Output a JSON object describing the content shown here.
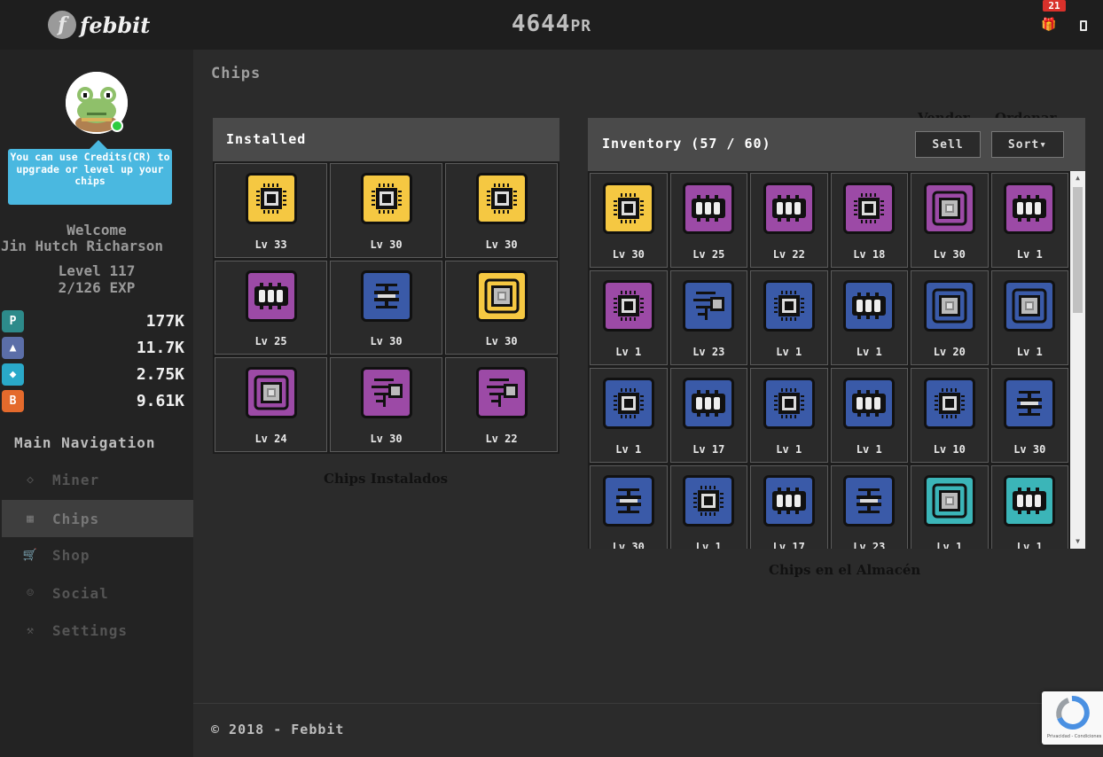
{
  "topbar": {
    "brand": "febbit",
    "pr_value": "4644",
    "pr_unit": "PR",
    "notifications": "21",
    "gift_icon": "gift-icon",
    "mobile_icon": "mobile-icon"
  },
  "sidebar": {
    "tip": "You can use Credits(CR) to upgrade or level up your chips",
    "welcome": "Welcome",
    "username": "Jin Hutch Richarson",
    "level": "Level 117",
    "exp": "2/126 EXP",
    "currencies": [
      {
        "icon": "coin-p-icon",
        "value": "177K",
        "color": "#2d8a8a"
      },
      {
        "icon": "mountain-icon",
        "value": "11.7K",
        "color": "#5b6ea8"
      },
      {
        "icon": "crystal-icon",
        "value": "2.75K",
        "color": "#2aa9c9"
      },
      {
        "icon": "bitcoin-icon",
        "value": "9.61K",
        "color": "#e46a2c"
      }
    ],
    "nav_heading": "Main Navigation",
    "nav": [
      {
        "label": "Miner",
        "icon": "diamond-icon"
      },
      {
        "label": "Chips",
        "icon": "grid-icon"
      },
      {
        "label": "Shop",
        "icon": "cart-icon"
      },
      {
        "label": "Social",
        "icon": "users-icon"
      },
      {
        "label": "Settings",
        "icon": "wrench-icon"
      }
    ]
  },
  "main": {
    "title": "Chips",
    "installed": {
      "title": "Installed",
      "caption": "Chips Instalados",
      "chips": [
        {
          "level": "Lv 33",
          "color": "yellow",
          "type": "cpu"
        },
        {
          "level": "Lv 30",
          "color": "yellow",
          "type": "cpu"
        },
        {
          "level": "Lv 30",
          "color": "yellow",
          "type": "cpu"
        },
        {
          "level": "Lv 25",
          "color": "purple",
          "type": "ram"
        },
        {
          "level": "Lv 30",
          "color": "blue",
          "type": "fan"
        },
        {
          "level": "Lv 30",
          "color": "yellow",
          "type": "core"
        },
        {
          "level": "Lv 24",
          "color": "purple",
          "type": "core"
        },
        {
          "level": "Lv 30",
          "color": "purple",
          "type": "circuit"
        },
        {
          "level": "Lv 22",
          "color": "purple",
          "type": "circuit"
        }
      ]
    },
    "inventory": {
      "title": "Inventory (57 / 60)",
      "sell_label": "Sell",
      "sort_label": "Sort▾",
      "sell_annotation": "Vender",
      "sort_annotation": "Ordenar",
      "caption": "Chips en el Almacén",
      "chips": [
        {
          "level": "Lv 30",
          "color": "yellow",
          "type": "cpu"
        },
        {
          "level": "Lv 25",
          "color": "purple",
          "type": "ram"
        },
        {
          "level": "Lv 22",
          "color": "purple",
          "type": "ram"
        },
        {
          "level": "Lv 18",
          "color": "purple",
          "type": "cpu"
        },
        {
          "level": "Lv 30",
          "color": "purple",
          "type": "core"
        },
        {
          "level": "Lv 1",
          "color": "purple",
          "type": "ram"
        },
        {
          "level": "Lv 1",
          "color": "purple",
          "type": "cpu"
        },
        {
          "level": "Lv 23",
          "color": "blue",
          "type": "circuit"
        },
        {
          "level": "Lv 1",
          "color": "blue",
          "type": "cpu"
        },
        {
          "level": "Lv 1",
          "color": "blue",
          "type": "ram"
        },
        {
          "level": "Lv 20",
          "color": "blue",
          "type": "core"
        },
        {
          "level": "Lv 1",
          "color": "blue",
          "type": "core"
        },
        {
          "level": "Lv 1",
          "color": "blue",
          "type": "cpu"
        },
        {
          "level": "Lv 17",
          "color": "blue",
          "type": "ram"
        },
        {
          "level": "Lv 1",
          "color": "blue",
          "type": "cpu"
        },
        {
          "level": "Lv 1",
          "color": "blue",
          "type": "ram"
        },
        {
          "level": "Lv 10",
          "color": "blue",
          "type": "cpu"
        },
        {
          "level": "Lv 30",
          "color": "blue",
          "type": "fan"
        },
        {
          "level": "Lv 30",
          "color": "blue",
          "type": "fan"
        },
        {
          "level": "Lv 1",
          "color": "blue",
          "type": "cpu"
        },
        {
          "level": "Lv 17",
          "color": "blue",
          "type": "ram"
        },
        {
          "level": "Lv 23",
          "color": "blue",
          "type": "fan"
        },
        {
          "level": "Lv 1",
          "color": "teal",
          "type": "core"
        },
        {
          "level": "Lv 1",
          "color": "teal",
          "type": "ram"
        }
      ]
    }
  },
  "footer": {
    "text": "© 2018 - Febbit",
    "recaptcha_text": "Privacidad - Condiciones"
  },
  "colors": {
    "yellow": "#f5c842",
    "purple": "#9c4aa6",
    "blue": "#3a5aa8",
    "teal": "#3bb5b8"
  }
}
